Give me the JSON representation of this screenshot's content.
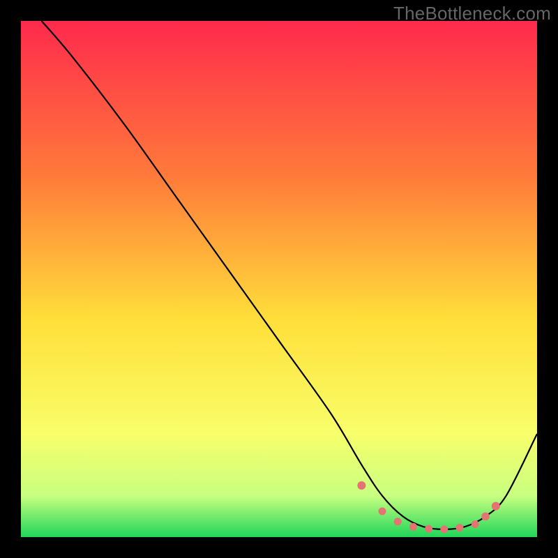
{
  "watermark": "TheBottleneck.com",
  "gradient": {
    "top_color": "#ff2a4d",
    "mid1_color": "#ff7a3a",
    "mid2_color": "#ffdf3a",
    "mid3_color": "#f8ff6a",
    "mid4_color": "#c8ff80",
    "bottom_color": "#1fd65a"
  },
  "chart_data": {
    "type": "line",
    "title": "",
    "xlabel": "",
    "ylabel": "",
    "xlim": [
      0,
      100
    ],
    "ylim": [
      0,
      100
    ],
    "series": [
      {
        "name": "bottleneck-curve",
        "x": [
          4,
          10,
          20,
          30,
          40,
          50,
          60,
          66,
          70,
          74,
          78,
          82,
          86,
          90,
          94,
          100
        ],
        "y": [
          100,
          93,
          80,
          66,
          52,
          38,
          24,
          14,
          8,
          4,
          2,
          1.5,
          2,
          4,
          8,
          20
        ]
      }
    ],
    "markers": {
      "name": "highlight-points",
      "color": "#e57373",
      "x": [
        66,
        70,
        73,
        76,
        79,
        82,
        85,
        88,
        90,
        92
      ],
      "y": [
        10,
        5,
        3,
        2,
        1.6,
        1.5,
        1.8,
        2.5,
        4,
        6
      ],
      "r": [
        6,
        5.5,
        5.5,
        5.5,
        5.5,
        5.5,
        5.5,
        5.5,
        5.8,
        6
      ]
    }
  }
}
